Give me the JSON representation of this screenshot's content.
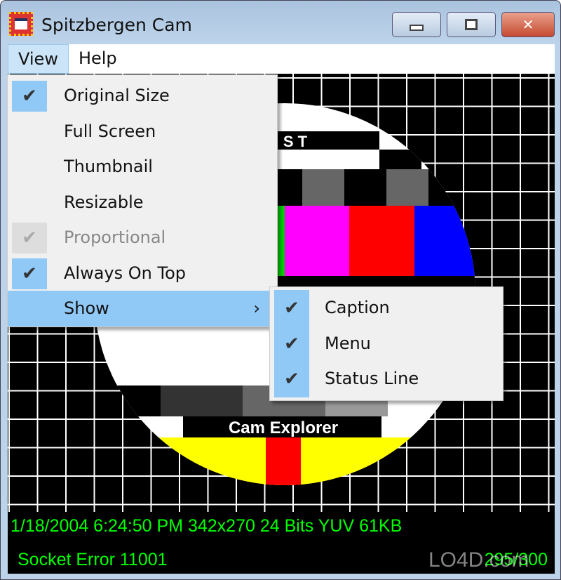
{
  "window": {
    "title": "Spitzbergen Cam",
    "controls": {
      "minimize": "minimize-icon",
      "maximize": "maximize-icon",
      "close": "close-icon"
    }
  },
  "menubar": {
    "items": [
      {
        "label": "View"
      },
      {
        "label": "Help"
      }
    ]
  },
  "view_menu": {
    "items": [
      {
        "label": "Original Size",
        "checked": true
      },
      {
        "label": "Full Screen",
        "checked": false
      },
      {
        "label": "Thumbnail",
        "checked": false
      },
      {
        "label": "Resizable",
        "checked": false
      },
      {
        "label": "Proportional",
        "checked": true,
        "disabled": true
      },
      {
        "label": "Always On Top",
        "checked": true
      },
      {
        "label": "Show",
        "submenu": true,
        "arrow": "›"
      }
    ]
  },
  "show_submenu": {
    "items": [
      {
        "label": "Caption",
        "checked": true
      },
      {
        "label": "Menu",
        "checked": true
      },
      {
        "label": "Status Line",
        "checked": true
      }
    ]
  },
  "test_card": {
    "top_text": "S T",
    "bottom_text": "Cam Explorer"
  },
  "status": {
    "line1": "1/18/2004 6:24:50 PM 342x270 24 Bits YUV 61KB",
    "error": "Socket Error  11001",
    "counter": "295/300",
    "color": "#00ff00"
  },
  "watermark": "LO4D.com"
}
